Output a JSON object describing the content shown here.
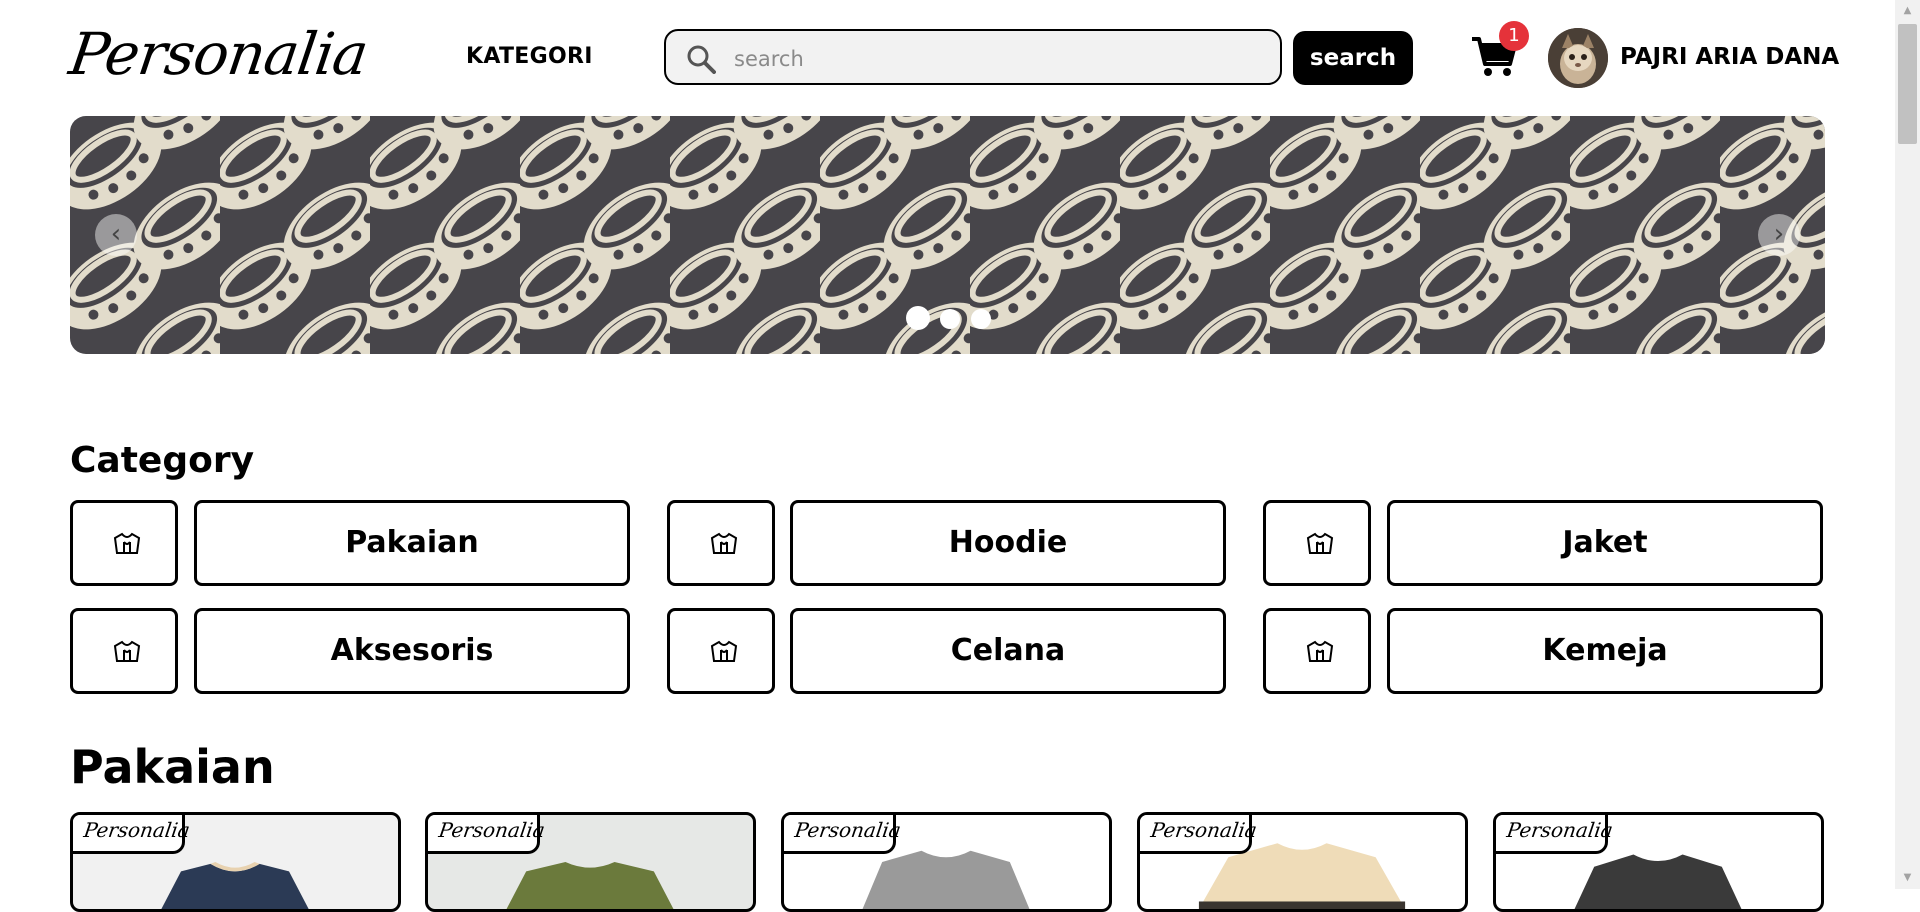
{
  "header": {
    "logo_text": "Personalia",
    "nav_kategori": "KATEGORI",
    "search_placeholder": "search",
    "search_value": "",
    "search_button": "search",
    "cart_count": "1",
    "user_name": "PAJRI ARIA DANA",
    "icons": {
      "search": "search-icon",
      "cart": "cart-icon",
      "avatar": "avatar"
    }
  },
  "banner": {
    "prev_icon": "‹",
    "next_icon": "›",
    "slide_count": 3,
    "active_slide": 1,
    "colors": {
      "background": "#47454a",
      "pattern": "#e2dccb"
    }
  },
  "categories": {
    "title": "Category",
    "items": [
      {
        "label": "Pakaian",
        "icon": "hoodie-icon"
      },
      {
        "label": "Hoodie",
        "icon": "hoodie-icon"
      },
      {
        "label": "Jaket",
        "icon": "hoodie-icon"
      },
      {
        "label": "Aksesoris",
        "icon": "hoodie-icon"
      },
      {
        "label": "Celana",
        "icon": "hoodie-icon"
      },
      {
        "label": "Kemeja",
        "icon": "hoodie-icon"
      }
    ]
  },
  "products_section": {
    "title": "Pakaian",
    "cards": [
      {
        "brand": "Personalia",
        "shirt_color": "#2b3a55",
        "bg": "#f1f1f1"
      },
      {
        "brand": "Personalia",
        "shirt_color": "#6b7a3c",
        "bg": "#e6e8e6"
      },
      {
        "brand": "Personalia",
        "shirt_color": "#9a9a9a",
        "bg": "#ffffff"
      },
      {
        "brand": "Personalia",
        "shirt_color": "#efdcb8",
        "bg": "#ffffff"
      },
      {
        "brand": "Personalia",
        "shirt_color": "#3a3a3a",
        "bg": "#ffffff"
      }
    ]
  }
}
